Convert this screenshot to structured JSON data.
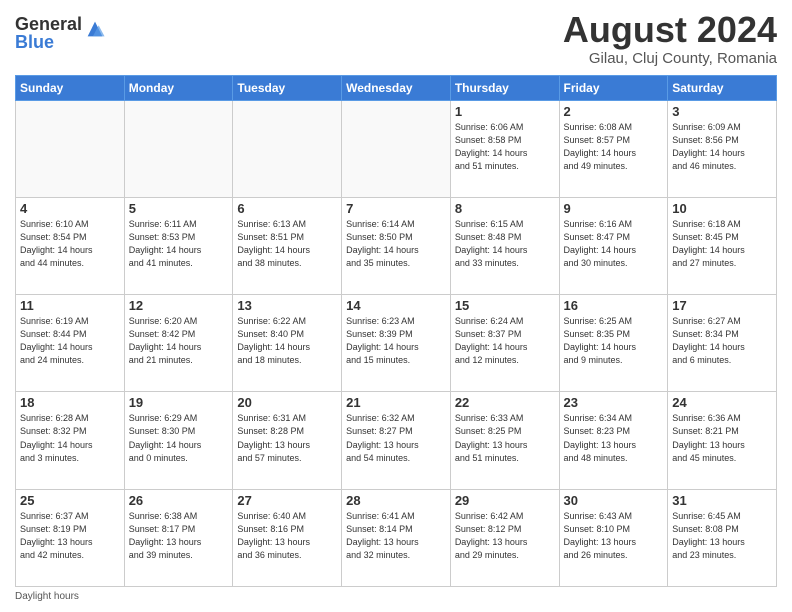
{
  "header": {
    "logo_general": "General",
    "logo_blue": "Blue",
    "month_title": "August 2024",
    "location": "Gilau, Cluj County, Romania"
  },
  "days_of_week": [
    "Sunday",
    "Monday",
    "Tuesday",
    "Wednesday",
    "Thursday",
    "Friday",
    "Saturday"
  ],
  "weeks": [
    [
      {
        "day": "",
        "info": ""
      },
      {
        "day": "",
        "info": ""
      },
      {
        "day": "",
        "info": ""
      },
      {
        "day": "",
        "info": ""
      },
      {
        "day": "1",
        "info": "Sunrise: 6:06 AM\nSunset: 8:58 PM\nDaylight: 14 hours\nand 51 minutes."
      },
      {
        "day": "2",
        "info": "Sunrise: 6:08 AM\nSunset: 8:57 PM\nDaylight: 14 hours\nand 49 minutes."
      },
      {
        "day": "3",
        "info": "Sunrise: 6:09 AM\nSunset: 8:56 PM\nDaylight: 14 hours\nand 46 minutes."
      }
    ],
    [
      {
        "day": "4",
        "info": "Sunrise: 6:10 AM\nSunset: 8:54 PM\nDaylight: 14 hours\nand 44 minutes."
      },
      {
        "day": "5",
        "info": "Sunrise: 6:11 AM\nSunset: 8:53 PM\nDaylight: 14 hours\nand 41 minutes."
      },
      {
        "day": "6",
        "info": "Sunrise: 6:13 AM\nSunset: 8:51 PM\nDaylight: 14 hours\nand 38 minutes."
      },
      {
        "day": "7",
        "info": "Sunrise: 6:14 AM\nSunset: 8:50 PM\nDaylight: 14 hours\nand 35 minutes."
      },
      {
        "day": "8",
        "info": "Sunrise: 6:15 AM\nSunset: 8:48 PM\nDaylight: 14 hours\nand 33 minutes."
      },
      {
        "day": "9",
        "info": "Sunrise: 6:16 AM\nSunset: 8:47 PM\nDaylight: 14 hours\nand 30 minutes."
      },
      {
        "day": "10",
        "info": "Sunrise: 6:18 AM\nSunset: 8:45 PM\nDaylight: 14 hours\nand 27 minutes."
      }
    ],
    [
      {
        "day": "11",
        "info": "Sunrise: 6:19 AM\nSunset: 8:44 PM\nDaylight: 14 hours\nand 24 minutes."
      },
      {
        "day": "12",
        "info": "Sunrise: 6:20 AM\nSunset: 8:42 PM\nDaylight: 14 hours\nand 21 minutes."
      },
      {
        "day": "13",
        "info": "Sunrise: 6:22 AM\nSunset: 8:40 PM\nDaylight: 14 hours\nand 18 minutes."
      },
      {
        "day": "14",
        "info": "Sunrise: 6:23 AM\nSunset: 8:39 PM\nDaylight: 14 hours\nand 15 minutes."
      },
      {
        "day": "15",
        "info": "Sunrise: 6:24 AM\nSunset: 8:37 PM\nDaylight: 14 hours\nand 12 minutes."
      },
      {
        "day": "16",
        "info": "Sunrise: 6:25 AM\nSunset: 8:35 PM\nDaylight: 14 hours\nand 9 minutes."
      },
      {
        "day": "17",
        "info": "Sunrise: 6:27 AM\nSunset: 8:34 PM\nDaylight: 14 hours\nand 6 minutes."
      }
    ],
    [
      {
        "day": "18",
        "info": "Sunrise: 6:28 AM\nSunset: 8:32 PM\nDaylight: 14 hours\nand 3 minutes."
      },
      {
        "day": "19",
        "info": "Sunrise: 6:29 AM\nSunset: 8:30 PM\nDaylight: 14 hours\nand 0 minutes."
      },
      {
        "day": "20",
        "info": "Sunrise: 6:31 AM\nSunset: 8:28 PM\nDaylight: 13 hours\nand 57 minutes."
      },
      {
        "day": "21",
        "info": "Sunrise: 6:32 AM\nSunset: 8:27 PM\nDaylight: 13 hours\nand 54 minutes."
      },
      {
        "day": "22",
        "info": "Sunrise: 6:33 AM\nSunset: 8:25 PM\nDaylight: 13 hours\nand 51 minutes."
      },
      {
        "day": "23",
        "info": "Sunrise: 6:34 AM\nSunset: 8:23 PM\nDaylight: 13 hours\nand 48 minutes."
      },
      {
        "day": "24",
        "info": "Sunrise: 6:36 AM\nSunset: 8:21 PM\nDaylight: 13 hours\nand 45 minutes."
      }
    ],
    [
      {
        "day": "25",
        "info": "Sunrise: 6:37 AM\nSunset: 8:19 PM\nDaylight: 13 hours\nand 42 minutes."
      },
      {
        "day": "26",
        "info": "Sunrise: 6:38 AM\nSunset: 8:17 PM\nDaylight: 13 hours\nand 39 minutes."
      },
      {
        "day": "27",
        "info": "Sunrise: 6:40 AM\nSunset: 8:16 PM\nDaylight: 13 hours\nand 36 minutes."
      },
      {
        "day": "28",
        "info": "Sunrise: 6:41 AM\nSunset: 8:14 PM\nDaylight: 13 hours\nand 32 minutes."
      },
      {
        "day": "29",
        "info": "Sunrise: 6:42 AM\nSunset: 8:12 PM\nDaylight: 13 hours\nand 29 minutes."
      },
      {
        "day": "30",
        "info": "Sunrise: 6:43 AM\nSunset: 8:10 PM\nDaylight: 13 hours\nand 26 minutes."
      },
      {
        "day": "31",
        "info": "Sunrise: 6:45 AM\nSunset: 8:08 PM\nDaylight: 13 hours\nand 23 minutes."
      }
    ]
  ],
  "footer": {
    "daylight_label": "Daylight hours"
  },
  "colors": {
    "header_bg": "#3a7bd5",
    "accent": "#3a7bd5"
  }
}
